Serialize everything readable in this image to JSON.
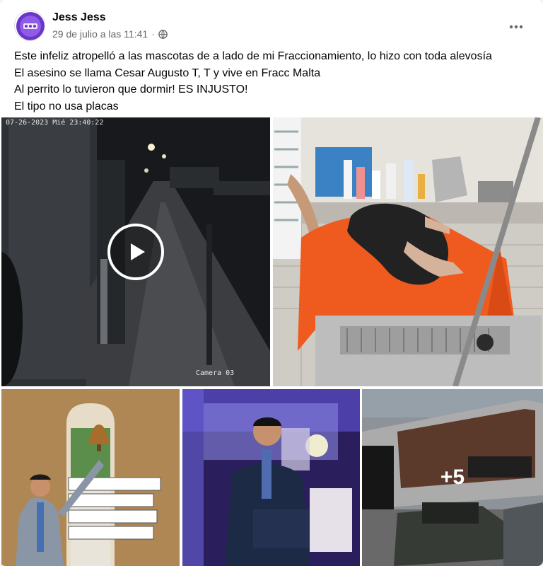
{
  "post": {
    "author": "Jess Jess",
    "date": "29 de julio a las 11:41",
    "separator": "·",
    "privacy_icon": "globe-icon",
    "more_icon": "more-options-icon",
    "text_lines": [
      "Este infeliz atropelló a las mascotas de a lado de mi Fraccionamiento, lo hizo con toda alevosía",
      "El asesino se llama Cesar Augusto T, T y vive en Fracc Malta",
      "Al perrito lo tuvieron que dormir! ES INJUSTO!",
      "El tipo no usa placas"
    ]
  },
  "media": {
    "video": {
      "timestamp": "07-26-2023 Mié 23:40:22",
      "camera_label": "Camera 03",
      "play_icon": "play-icon"
    },
    "more_count": "+5"
  },
  "colors": {
    "text": "#050505",
    "secondary_text": "#65676b",
    "towel": "#f0581e",
    "avatar_ring": "#6a35c9"
  }
}
